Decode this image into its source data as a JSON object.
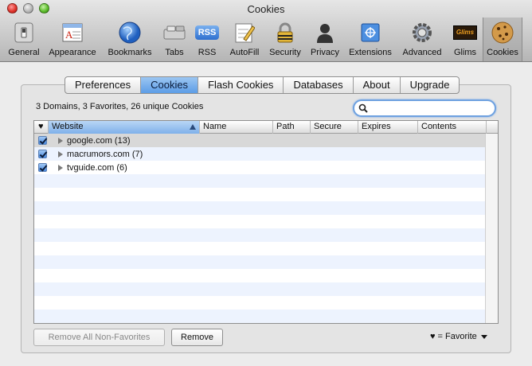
{
  "window": {
    "title": "Cookies"
  },
  "toolbar": {
    "items": [
      {
        "label": "General",
        "icon": "switch-icon"
      },
      {
        "label": "Appearance",
        "icon": "appearance-icon"
      },
      {
        "label": "Bookmarks",
        "icon": "globe-icon"
      },
      {
        "label": "Tabs",
        "icon": "tabs-icon"
      },
      {
        "label": "RSS",
        "icon": "rss-icon"
      },
      {
        "label": "AutoFill",
        "icon": "pencil-icon"
      },
      {
        "label": "Security",
        "icon": "lock-icon"
      },
      {
        "label": "Privacy",
        "icon": "person-icon"
      },
      {
        "label": "Extensions",
        "icon": "extensions-icon"
      },
      {
        "label": "Advanced",
        "icon": "gear-icon"
      },
      {
        "label": "Glims",
        "icon": "glims-icon"
      },
      {
        "label": "Cookies",
        "icon": "cookie-icon"
      }
    ],
    "active": "Cookies",
    "rss_badge": "RSS",
    "glims_badge": "Glims"
  },
  "tabs": [
    {
      "label": "Preferences"
    },
    {
      "label": "Cookies"
    },
    {
      "label": "Flash Cookies"
    },
    {
      "label": "Databases"
    },
    {
      "label": "About"
    },
    {
      "label": "Upgrade"
    }
  ],
  "summary": "3 Domains, 3 Favorites, 26 unique Cookies",
  "search": {
    "value": "",
    "placeholder": ""
  },
  "table": {
    "favorite_header": "♥",
    "columns": [
      "Website",
      "Name",
      "Path",
      "Secure",
      "Expires",
      "Contents"
    ],
    "sorted_column": "Website",
    "rows": [
      {
        "website": "google.com (13)",
        "favorite": true
      },
      {
        "website": "macrumors.com (7)",
        "favorite": true
      },
      {
        "website": "tvguide.com (6)",
        "favorite": true
      }
    ]
  },
  "buttons": {
    "remove_all_non_favorites": "Remove All Non-Favorites",
    "remove": "Remove"
  },
  "favorite_legend": {
    "symbol": "♥",
    "text": "= Favorite"
  },
  "colors": {
    "accent": "#5c9de6",
    "close": "#e0342c",
    "zoom": "#5fbf2e"
  }
}
